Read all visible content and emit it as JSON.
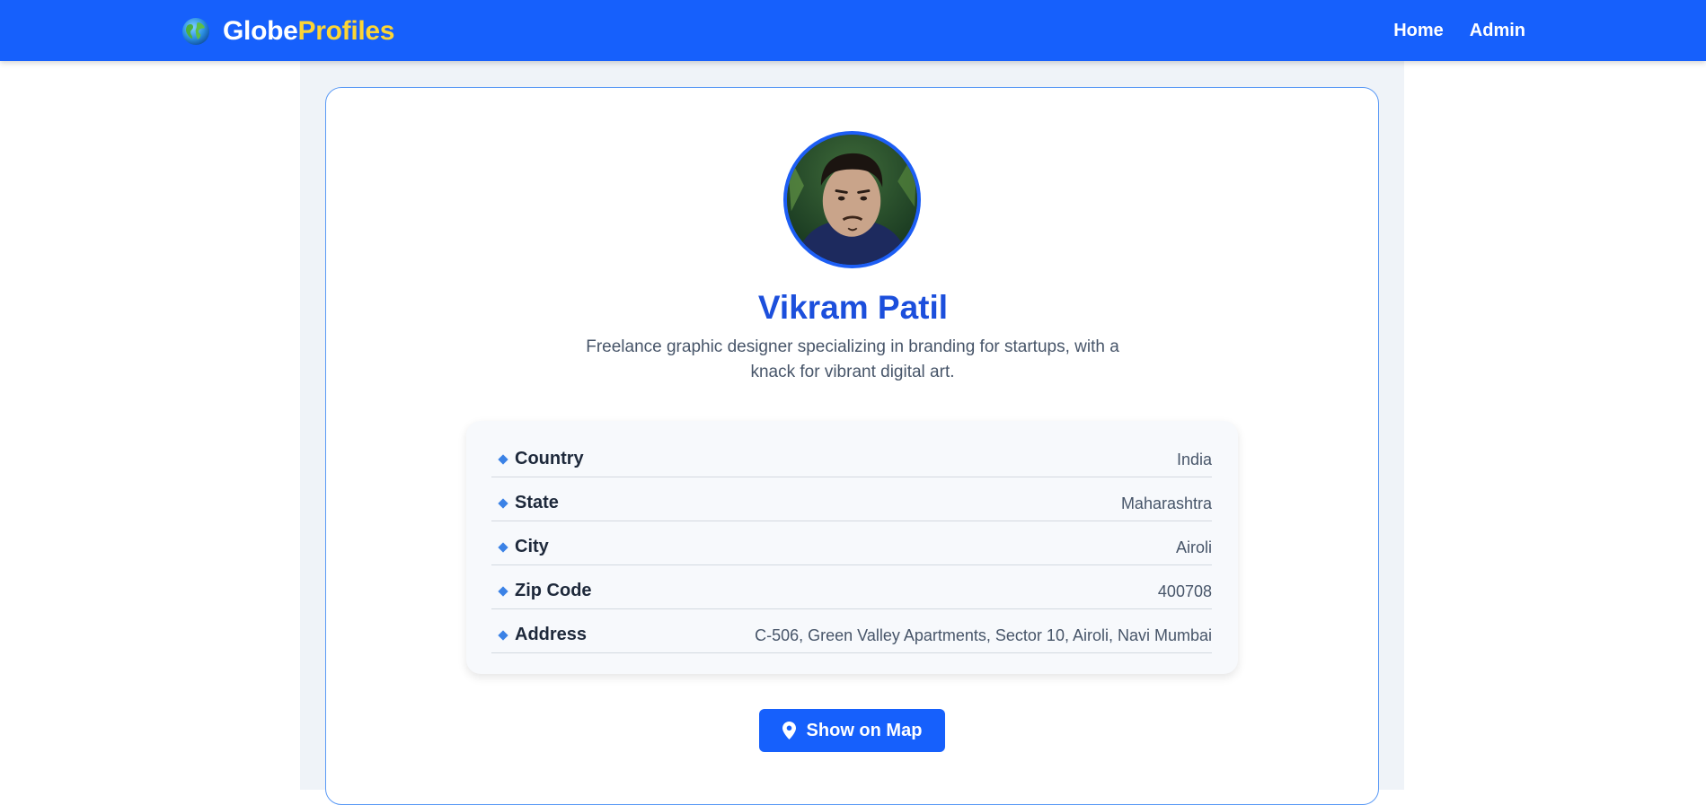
{
  "navbar": {
    "brand_part1": "Globe",
    "brand_part2": "Profiles",
    "brand_icon": "globe-icon",
    "links": [
      "Home",
      "Admin"
    ]
  },
  "profile": {
    "name": "Vikram Patil",
    "bio": "Freelance graphic designer specializing in branding for startups, with a knack for vibrant digital art.",
    "avatar_icon": "avatar-photo"
  },
  "details": [
    {
      "label": "Country",
      "value": "India"
    },
    {
      "label": "State",
      "value": "Maharashtra"
    },
    {
      "label": "City",
      "value": "Airoli"
    },
    {
      "label": "Zip Code",
      "value": "400708"
    },
    {
      "label": "Address",
      "value": "C-506, Green Valley Apartments, Sector 10, Airoli, Navi Mumbai"
    }
  ],
  "actions": {
    "map_button_label": "Show on Map",
    "map_button_icon": "map-pin-icon"
  },
  "colors": {
    "primary": "#1660fc",
    "name": "#1c4fdc",
    "brand_accent": "#fcd535",
    "bullet": "#3b82e6"
  }
}
